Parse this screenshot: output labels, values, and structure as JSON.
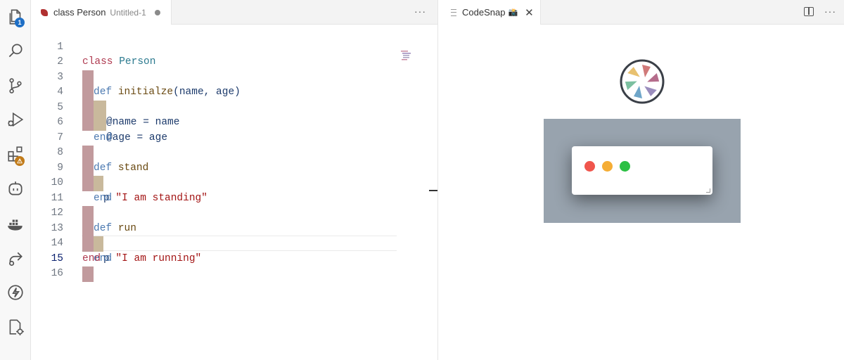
{
  "activity_bar": {
    "explorer_badge": "1",
    "extensions_badge": "⚠"
  },
  "editor": {
    "tab": {
      "title": "class Person",
      "description": "Untitled-1"
    },
    "lines": [
      {
        "n": "1"
      },
      {
        "n": "2"
      },
      {
        "n": "3"
      },
      {
        "n": "4"
      },
      {
        "n": "5"
      },
      {
        "n": "6"
      },
      {
        "n": "7"
      },
      {
        "n": "8"
      },
      {
        "n": "9"
      },
      {
        "n": "10"
      },
      {
        "n": "11"
      },
      {
        "n": "12"
      },
      {
        "n": "13"
      },
      {
        "n": "14"
      },
      {
        "n": "15"
      },
      {
        "n": "16"
      }
    ],
    "code": {
      "l1_kw": "class",
      "l1_name": "Person",
      "l2_kw": "def",
      "l2_name": "initialze",
      "l2_params": "(name, age)",
      "l3_var": "@name",
      "l3_rest": " = name",
      "l4_var": "@age",
      "l4_rest": " = age",
      "l5": "end",
      "l7_kw": "def",
      "l7_name": "stand",
      "l8_p": "p",
      "l8_str": "\"I am standing\"",
      "l9": "end",
      "l11_kw": "def",
      "l11_name": "run",
      "l12_p": "p",
      "l12_str": "\"I am running\"",
      "l13": "end",
      "l14": "end"
    }
  },
  "codesnap": {
    "tab_title": "CodeSnap",
    "tab_emoji": "📸",
    "close_glyph": "✕"
  },
  "more_glyph": "···"
}
